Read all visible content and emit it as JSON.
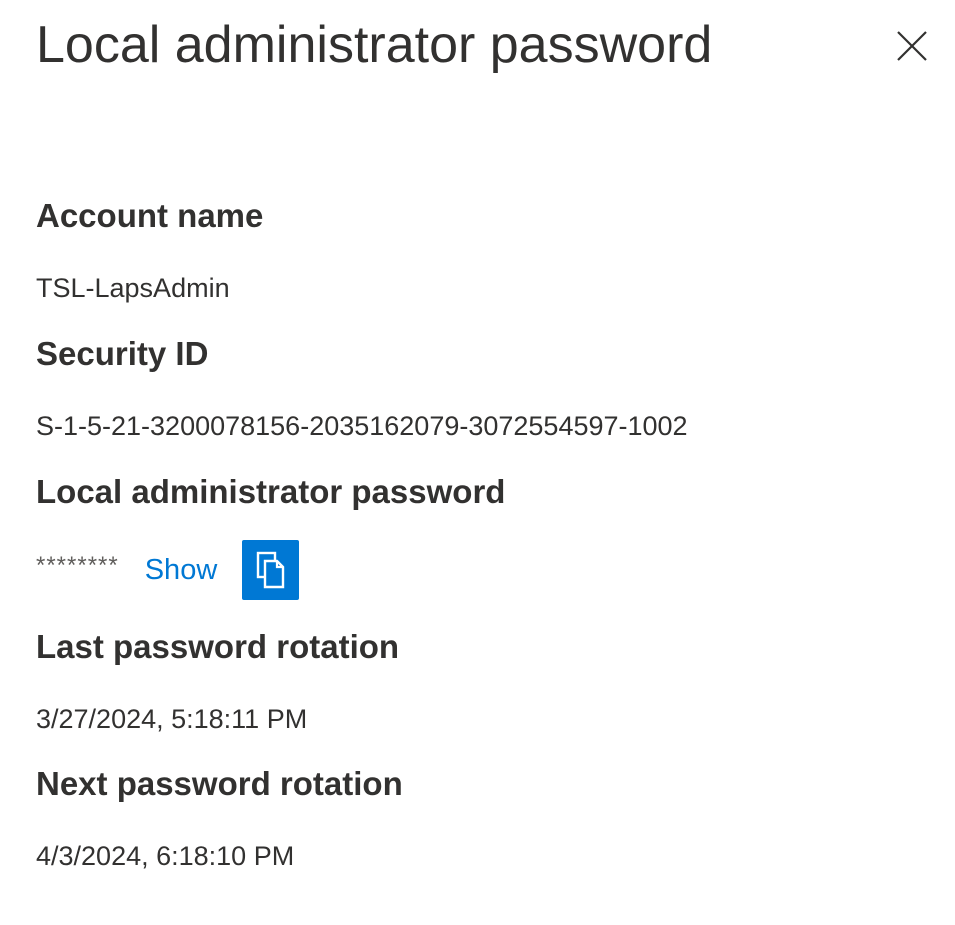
{
  "panel": {
    "title": "Local administrator password",
    "close_icon": "close-icon"
  },
  "fields": {
    "account_name": {
      "label": "Account name",
      "value": "TSL-LapsAdmin"
    },
    "security_id": {
      "label": "Security ID",
      "value": "S-1-5-21-3200078156-2035162079-3072554597-1002"
    },
    "local_admin_password": {
      "label": "Local administrator password",
      "masked_value": "********",
      "show_label": "Show",
      "copy_icon": "copy-icon"
    },
    "last_rotation": {
      "label": "Last password rotation",
      "value": "3/27/2024, 5:18:11 PM"
    },
    "next_rotation": {
      "label": "Next password rotation",
      "value": "4/3/2024, 6:18:10 PM"
    }
  },
  "colors": {
    "accent": "#0078d4",
    "text": "#323130",
    "muted_text": "#605e5c"
  }
}
